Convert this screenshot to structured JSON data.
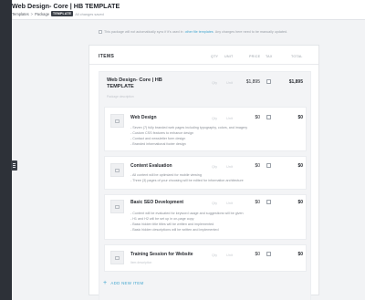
{
  "header": {
    "title": "Web Design- Core | HB TEMPLATE",
    "breadcrumb": [
      "Templates",
      "Package"
    ],
    "breadcrumb_sep": ">",
    "badge": "TEMPLATE",
    "saved_status": "All changes saved"
  },
  "notice": {
    "prefix": "This package will not automatically sync if it's used in",
    "link": "other file templates",
    "suffix": "Any changes here need to be manually updated."
  },
  "table": {
    "title": "ITEMS",
    "columns": [
      "QTY",
      "UNIT",
      "PRICE",
      "TAX",
      "TOTAL"
    ]
  },
  "package": {
    "name_line1": "Web Design- Core | HB",
    "name_line2": "TEMPLATE",
    "description_placeholder": "Package description",
    "qty_placeholder": "Qty",
    "unit_placeholder": "Unit",
    "price": "$1,895",
    "total": "$1,895",
    "tax_checked": false
  },
  "items": [
    {
      "name": "Web Design",
      "bullets": [
        "- Seven (7) fully branded web pages including typography, colors, and imagery",
        "- Custom CSS features to enhance design",
        "- Contact and newsletter form design",
        "- Branded informational footer design"
      ],
      "qty": "Qty",
      "unit": "Unit",
      "price": "$0",
      "total": "$0",
      "tax_checked": false
    },
    {
      "name": "Content Evaluation",
      "bullets": [
        "- All content will be optimized for mobile viewing",
        "- Three (3) pages of your choosing will be edited for information architecture"
      ],
      "qty": "Qty",
      "unit": "Unit",
      "price": "$0",
      "total": "$0",
      "tax_checked": false
    },
    {
      "name": "Basic SEO Development",
      "bullets": [
        "- Content will be evaluated for keyword usage and suggestions will be given",
        "- H1 and H2 will be set up in on-page copy",
        "- Basic hidden title titles will be written and implemented",
        "- Basic hidden descriptions will be written and implemented"
      ],
      "qty": "Qty",
      "unit": "Unit",
      "price": "$0",
      "total": "$0",
      "tax_checked": false
    },
    {
      "name": "Training Session for Website",
      "description_placeholder": "Item description",
      "qty": "Qty",
      "unit": "Unit",
      "price": "$0",
      "total": "$0",
      "tax_checked": false
    }
  ],
  "add_item_label": "ADD NEW ITEM",
  "colors": {
    "accent": "#45a7cf",
    "sidebar": "#2d3138"
  },
  "icons": [
    "menu-toggle-icon",
    "image-placeholder-icon",
    "plus-icon"
  ]
}
